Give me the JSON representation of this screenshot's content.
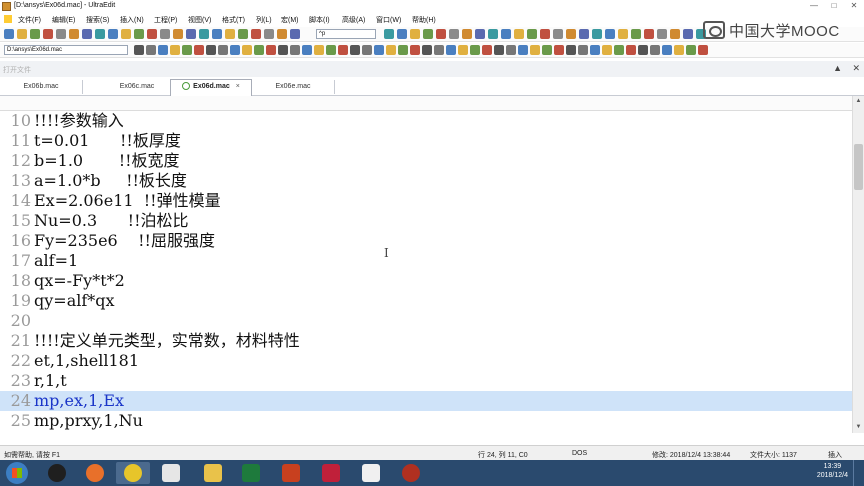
{
  "window": {
    "title": "[D:\\ansys\\Ex06d.mac] - UltraEdit",
    "controls": [
      "—",
      "□",
      "✕"
    ]
  },
  "menu": [
    {
      "label": "文件(F)"
    },
    {
      "label": "编辑(E)"
    },
    {
      "label": "搜索(S)"
    },
    {
      "label": "插入(N)"
    },
    {
      "label": "工程(P)"
    },
    {
      "label": "视图(V)"
    },
    {
      "label": "格式(T)"
    },
    {
      "label": "列(L)"
    },
    {
      "label": "宏(M)"
    },
    {
      "label": "脚本(I)"
    },
    {
      "label": "高级(A)"
    },
    {
      "label": "窗口(W)"
    },
    {
      "label": "帮助(H)"
    }
  ],
  "toolbar": {
    "search_combo_value": "^p",
    "path_combo_value": "D:\\ansys\\Ex06d.mac"
  },
  "logo": {
    "text": "中国大学MOOC"
  },
  "open_files": {
    "label": "打开文件",
    "controls": [
      "▲",
      "✕"
    ]
  },
  "tabs": [
    {
      "label": "Ex06b.mac",
      "active": false
    },
    {
      "label": "Ex06c.mac",
      "active": false
    },
    {
      "label": "Ex06d.mac",
      "active": true
    },
    {
      "label": "Ex06e.mac",
      "active": false
    }
  ],
  "tab_close": "×",
  "editor": {
    "lines": [
      {
        "num": "10",
        "text": "!!!!参数输入"
      },
      {
        "num": "11",
        "text": "t=0.01      !!板厚度"
      },
      {
        "num": "12",
        "text": "b=1.0       !!板宽度"
      },
      {
        "num": "13",
        "text": "a=1.0*b     !!板长度"
      },
      {
        "num": "14",
        "text": "Ex=2.06e11  !!弹性模量"
      },
      {
        "num": "15",
        "text": "Nu=0.3      !!泊松比"
      },
      {
        "num": "16",
        "text": "Fy=235e6    !!屈服强度"
      },
      {
        "num": "17",
        "text": "alf=1"
      },
      {
        "num": "18",
        "text": "qx=-Fy*t*2"
      },
      {
        "num": "19",
        "text": "qy=alf*qx"
      },
      {
        "num": "20",
        "text": ""
      },
      {
        "num": "21",
        "text": "!!!!定义单元类型，实常数，材料特性"
      },
      {
        "num": "22",
        "text": "et,1,shell181"
      },
      {
        "num": "23",
        "text": "r,1,t"
      },
      {
        "num": "24",
        "text": "mp,ex,1,Ex",
        "highlight": true
      },
      {
        "num": "25",
        "text": "mp,prxy,1,Nu"
      }
    ],
    "highlight_color": "#cfe3f9",
    "cursor_glyph": "I"
  },
  "statusbar": {
    "help": "如需帮助, 请按 F1",
    "position": "行 24, 列 11, C0",
    "format": "DOS",
    "modified": "修改: 2018/12/4 13:38:44",
    "filesize": "文件大小: 1137",
    "mode": "插入"
  },
  "taskbar": {
    "apps": [
      "qq-icon",
      "firefox-icon",
      "norton-icon",
      "window-icon",
      "explorer-icon",
      "excel-icon",
      "powerpoint-icon",
      "game-icon",
      "ansys-icon",
      "tool-icon"
    ],
    "clock_time": "13:39",
    "clock_date": "2018/12/4"
  }
}
